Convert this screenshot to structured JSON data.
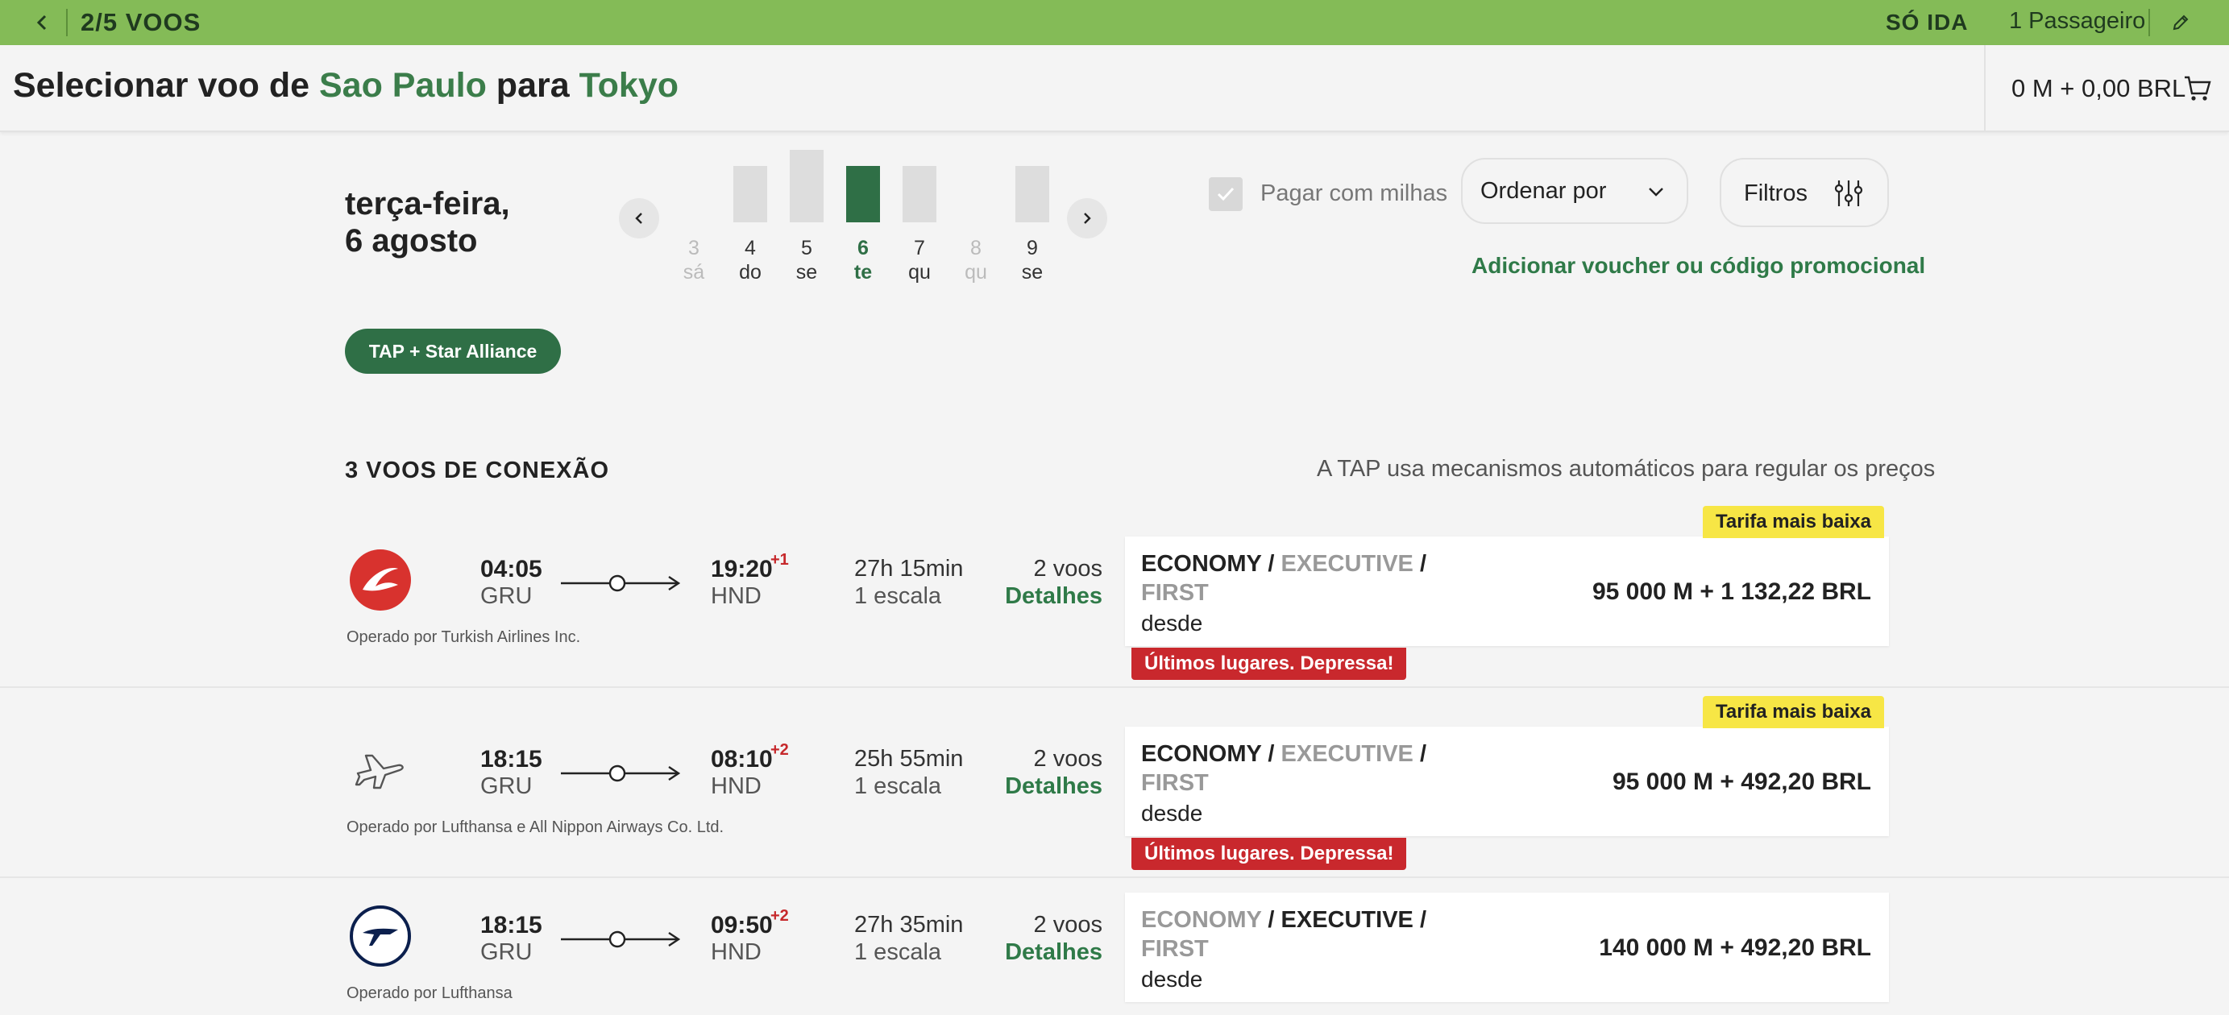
{
  "topbar": {
    "step": "2/5 VOOS",
    "trip_type": "SÓ IDA",
    "passengers": "1 Passageiro",
    "back_icon": "chevron-left-icon",
    "edit_icon": "pencil-icon",
    "color": "#84bb57"
  },
  "header": {
    "title_prefix": "Selecionar voo de ",
    "origin": "Sao Paulo",
    "title_middle": " para ",
    "destination": "Tokyo",
    "cart_total": "0 M + 0,00 BRL",
    "cart_icon": "cart-icon"
  },
  "date_selector": {
    "day_line1": "terça-feira,",
    "day_line2": "6 agosto",
    "days": [
      {
        "num": "3",
        "day": "sá",
        "available": false,
        "selected": false,
        "level": 0
      },
      {
        "num": "4",
        "day": "do",
        "available": true,
        "selected": false,
        "level": 0.78
      },
      {
        "num": "5",
        "day": "se",
        "available": true,
        "selected": false,
        "level": 1.0
      },
      {
        "num": "6",
        "day": "te",
        "available": true,
        "selected": true,
        "level": 0.78
      },
      {
        "num": "7",
        "day": "qu",
        "available": true,
        "selected": false,
        "level": 0.78
      },
      {
        "num": "8",
        "day": "qu",
        "available": false,
        "selected": false,
        "level": 0
      },
      {
        "num": "9",
        "day": "se",
        "available": true,
        "selected": false,
        "level": 0.78
      }
    ]
  },
  "controls": {
    "pay_with_miles": "Pagar com milhas",
    "sort_label": "Ordenar por",
    "filters_label": "Filtros",
    "voucher_link": "Adicionar voucher ou código promocional"
  },
  "alliance_chip": "TAP + Star Alliance",
  "results": {
    "title": "3 VOOS DE CONEXÃO",
    "note": "A TAP usa mecanismos automáticos para regular os preços"
  },
  "flights": [
    {
      "logo": "turkish-airlines-logo",
      "dep_time": "04:05",
      "dep_code": "GRU",
      "arr_time": "19:20",
      "arr_plus": "+1",
      "arr_code": "HND",
      "duration": "27h 15min",
      "stops": "1 escala",
      "voos": "2 voos",
      "details": "Detalhes",
      "operated": "Operado por Turkish Airlines Inc.",
      "fare_classes": [
        {
          "label": "ECONOMY",
          "active": true
        },
        {
          "label": "EXECUTIVE",
          "active": false
        },
        {
          "label": "FIRST",
          "active": false
        }
      ],
      "from": "desde",
      "price": "95 000 M + 1 132,22 BRL",
      "badge_top": "Tarifa mais baixa",
      "badge_bottom": "Últimos lugares. Depressa!"
    },
    {
      "logo": "airplane-icon",
      "dep_time": "18:15",
      "dep_code": "GRU",
      "arr_time": "08:10",
      "arr_plus": "+2",
      "arr_code": "HND",
      "duration": "25h 55min",
      "stops": "1 escala",
      "voos": "2 voos",
      "details": "Detalhes",
      "operated": "Operado por Lufthansa e All Nippon Airways Co. Ltd.",
      "fare_classes": [
        {
          "label": "ECONOMY",
          "active": true
        },
        {
          "label": "EXECUTIVE",
          "active": false
        },
        {
          "label": "FIRST",
          "active": false
        }
      ],
      "from": "desde",
      "price": "95 000 M + 492,20 BRL",
      "badge_top": "Tarifa mais baixa",
      "badge_bottom": "Últimos lugares. Depressa!"
    },
    {
      "logo": "lufthansa-logo",
      "dep_time": "18:15",
      "dep_code": "GRU",
      "arr_time": "09:50",
      "arr_plus": "+2",
      "arr_code": "HND",
      "duration": "27h 35min",
      "stops": "1 escala",
      "voos": "2 voos",
      "details": "Detalhes",
      "operated": "Operado por Lufthansa",
      "fare_classes": [
        {
          "label": "ECONOMY",
          "active": false
        },
        {
          "label": "EXECUTIVE",
          "active": true
        },
        {
          "label": "FIRST",
          "active": false
        }
      ],
      "from": "desde",
      "price": "140 000 M + 492,20 BRL"
    }
  ],
  "colors": {
    "brand_green": "#2f6f46",
    "link_green": "#2f7a48",
    "alert_red": "#c9282d",
    "badge_yellow": "#f7e645"
  }
}
